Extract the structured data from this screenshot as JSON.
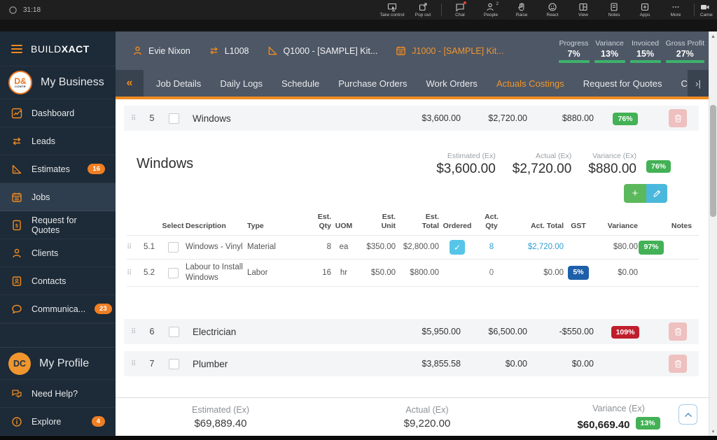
{
  "glyphs": {
    "drag": "⠿",
    "back": "«",
    "forward": "›|",
    "check": "✓",
    "plus": "+",
    "scroll_up": "▲",
    "scroll_down": "▾"
  },
  "colors": {
    "accent": "#ef8b21",
    "green": "#43b155",
    "red": "#bf1f2d",
    "navy": "#1e5fa9",
    "teal": "#56c5e8",
    "blue": "#2e9fd4",
    "header": "#4e5765",
    "sidebar": "#1d2a37"
  },
  "meeting_bar": {
    "timer": "31:18",
    "controls": [
      {
        "label": "Take control"
      },
      {
        "label": "Pop out"
      },
      {
        "label": "Chat"
      },
      {
        "label": "People"
      },
      {
        "label": "Raise"
      },
      {
        "label": "React"
      },
      {
        "label": "View"
      },
      {
        "label": "Notes"
      },
      {
        "label": "Apps"
      },
      {
        "label": "More"
      },
      {
        "label": "Camer"
      }
    ],
    "people_count": "2"
  },
  "sidebar": {
    "logo_build": "BUILD",
    "logo_xact": "XACT",
    "business": {
      "avatar_line1": "D&",
      "avatar_line2": "CONTR",
      "label": "My Business"
    },
    "items": [
      {
        "label": "Dashboard"
      },
      {
        "label": "Leads"
      },
      {
        "label": "Estimates",
        "badge": "16"
      },
      {
        "label": "Jobs"
      },
      {
        "label": "Request for Quotes"
      },
      {
        "label": "Clients"
      },
      {
        "label": "Contacts"
      },
      {
        "label": "Communica...",
        "badge": "23"
      }
    ],
    "profile": {
      "initials": "DC",
      "label": "My Profile"
    },
    "help": "Need Help?",
    "explore": {
      "label": "Explore",
      "badge": "4"
    }
  },
  "header": {
    "breadcrumbs": [
      {
        "label": "Evie Nixon"
      },
      {
        "label": "L1008"
      },
      {
        "label": "Q1000 - [SAMPLE] Kit..."
      },
      {
        "label": "J1000 - [SAMPLE] Kit..."
      }
    ],
    "stats": [
      {
        "label": "Progress",
        "value": "7%"
      },
      {
        "label": "Variance",
        "value": "13%"
      },
      {
        "label": "Invoiced",
        "value": "15%"
      },
      {
        "label": "Gross Profit",
        "value": "27%"
      }
    ]
  },
  "tabs": [
    {
      "label": "Job Details"
    },
    {
      "label": "Daily Logs"
    },
    {
      "label": "Schedule"
    },
    {
      "label": "Purchase Orders"
    },
    {
      "label": "Work Orders"
    },
    {
      "label": "Actuals Costings"
    },
    {
      "label": "Request for Quotes"
    },
    {
      "label": "Cl"
    }
  ],
  "groups": [
    {
      "num": "5",
      "name": "Windows",
      "estimated": "$3,600.00",
      "actual": "$2,720.00",
      "variance": "$880.00",
      "badge": "76%"
    },
    {
      "num": "6",
      "name": "Electrician",
      "estimated": "$5,950.00",
      "actual": "$6,500.00",
      "variance": "-$550.00",
      "badge": "109%"
    },
    {
      "num": "7",
      "name": "Plumber",
      "estimated": "$3,855.58",
      "actual": "$0.00",
      "variance": "$0.00"
    }
  ],
  "section": {
    "title": "Windows",
    "estimated_label": "Estimated (Ex)",
    "estimated": "$3,600.00",
    "actual_label": "Actual (Ex)",
    "actual": "$2,720.00",
    "variance_label": "Variance (Ex)",
    "variance": "$880.00",
    "badge": "76%"
  },
  "table": {
    "headers": {
      "select": "Select",
      "description": "Description",
      "type": "Type",
      "est_qty": "Est.\nQty",
      "uom": "UOM",
      "est_unit": "Est.\nUnit",
      "est_total": "Est.\nTotal",
      "ordered": "Ordered",
      "act_qty": "Act.\nQty",
      "act_total": "Act. Total",
      "gst": "GST",
      "variance": "Variance",
      "notes": "Notes"
    },
    "rows": [
      {
        "num": "5.1",
        "description": "Windows - Vinyl",
        "type": "Material",
        "est_qty": "8",
        "uom": "ea",
        "est_unit": "$350.00",
        "est_total": "$2,800.00",
        "act_qty": "8",
        "act_total": "$2,720.00",
        "variance": "$80.00",
        "variance_badge": "97%"
      },
      {
        "num": "5.2",
        "description": "Labour to Install Windows",
        "type": "Labor",
        "est_qty": "16",
        "uom": "hr",
        "est_unit": "$50.00",
        "est_total": "$800.00",
        "act_qty": "0",
        "act_total": "$0.00",
        "gst_badge": "5%",
        "variance": "$0.00"
      }
    ]
  },
  "footer": {
    "estimated_label": "Estimated (Ex)",
    "estimated": "$69,889.40",
    "actual_label": "Actual (Ex)",
    "actual": "$9,220.00",
    "variance_label": "Variance (Ex)",
    "variance": "$60,669.40",
    "variance_badge": "13%"
  }
}
